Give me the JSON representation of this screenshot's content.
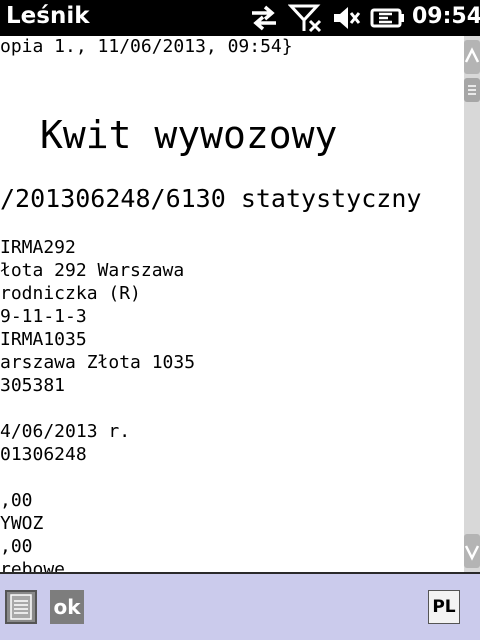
{
  "status_bar": {
    "app_title": "Leśnik",
    "time": "09:54",
    "icons": [
      "data-sync-icon",
      "no-signal-icon",
      "volume-muted-icon",
      "battery-charging-icon"
    ]
  },
  "document": {
    "header_line": "opia 1., 11/06/2013, 09:54}",
    "title": "Kwit wywozowy",
    "subtitle": "/201306248/6130 statystyczny",
    "lines": [
      "IRMA292",
      "łota 292 Warszawa",
      "rodniczka (R)",
      "9-11-1-3",
      "IRMA1035",
      "arszawa Złota 1035",
      "305381",
      "",
      "4/06/2013 r.",
      "01306248",
      "",
      ",00",
      "YWOZ",
      ",00",
      "rebowe"
    ]
  },
  "bottom_bar": {
    "list_button_icon": "list-icon",
    "ok_label": "ok",
    "language_label": "PL"
  },
  "colors": {
    "status_bar_bg": "#000000",
    "bottom_bar_bg": "#cbcbec",
    "scrollbar_bg": "#d8d8d8"
  }
}
